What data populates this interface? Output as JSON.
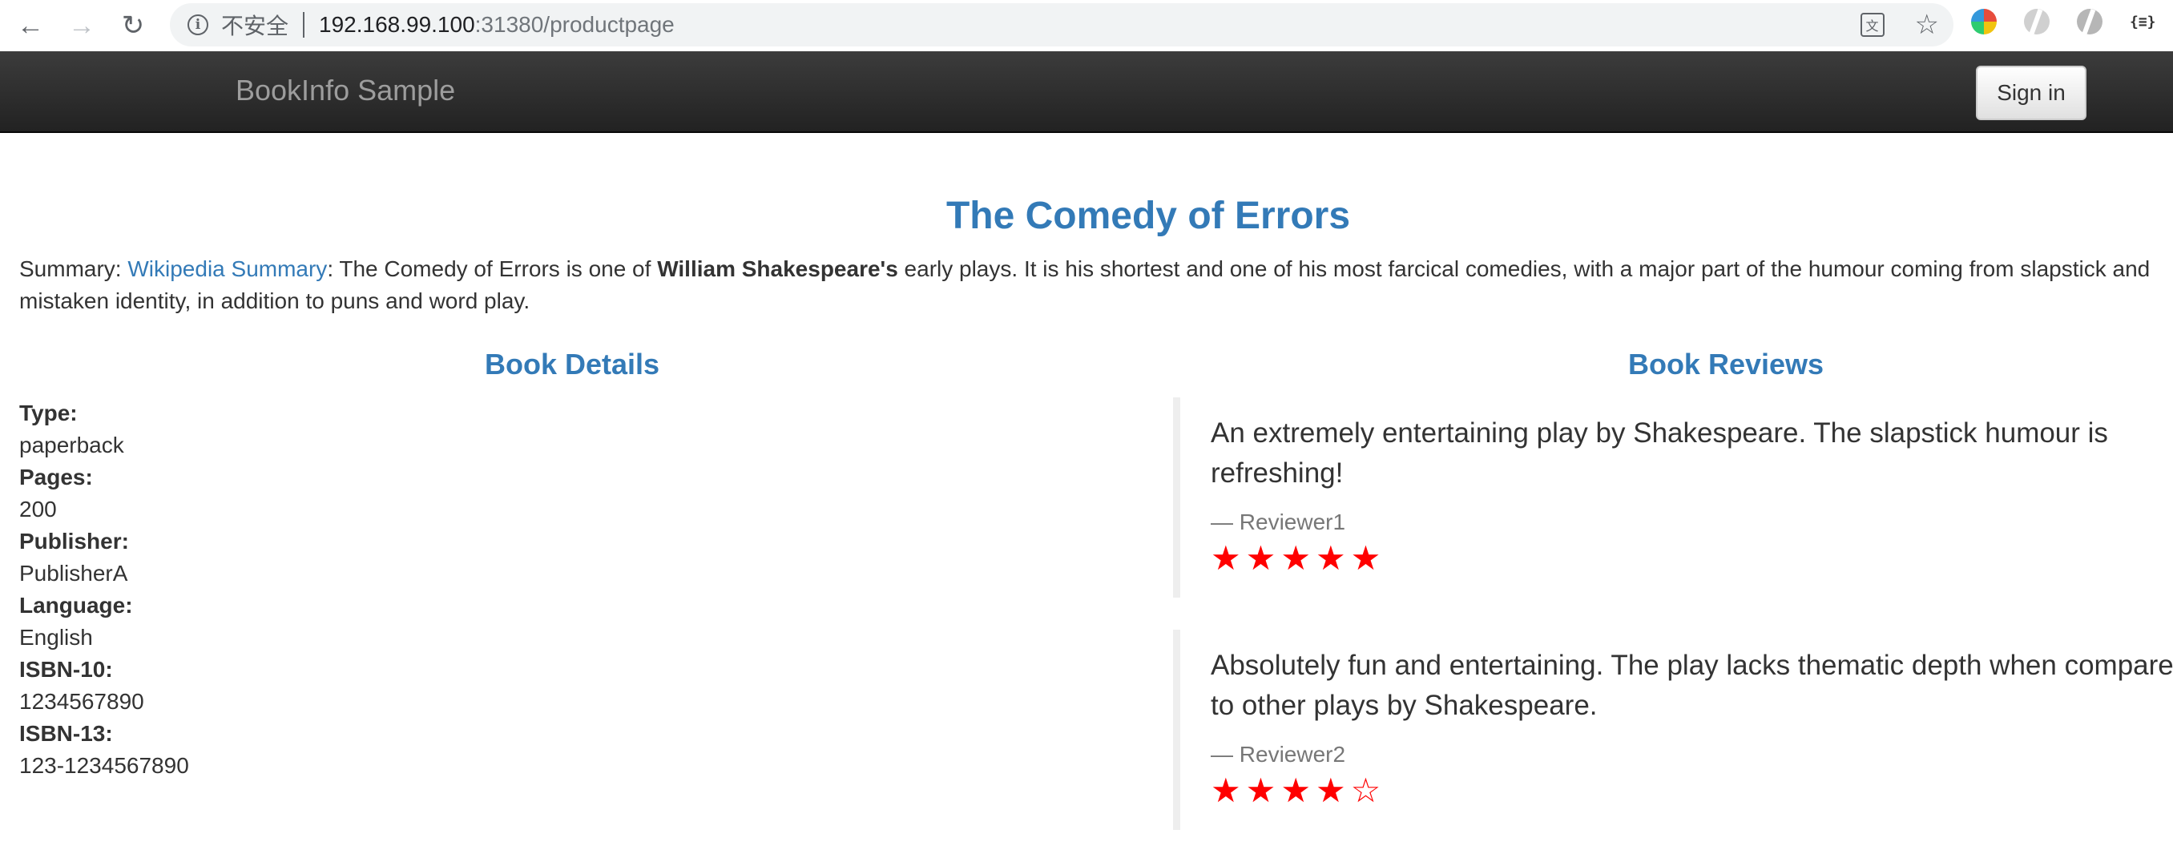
{
  "browser": {
    "insecure_label": "不安全",
    "url_host": "192.168.99.100",
    "url_rest": ":31380/productpage",
    "ext_braces": "{≡}"
  },
  "navbar": {
    "brand": "BookInfo Sample",
    "signin_label": "Sign in"
  },
  "product": {
    "title": "The Comedy of Errors",
    "summary_prefix": "Summary: ",
    "summary_link": "Wikipedia Summary",
    "summary_text_1": ": The Comedy of Errors is one of ",
    "summary_bold": "William Shakespeare's",
    "summary_text_2": " early plays. It is his shortest and one of his most farcical comedies, with a major part of the humour coming from slapstick and mistaken identity, in addition to puns and word play."
  },
  "details": {
    "heading": "Book Details",
    "items": [
      {
        "label": "Type:",
        "value": "paperback"
      },
      {
        "label": "Pages:",
        "value": "200"
      },
      {
        "label": "Publisher:",
        "value": "PublisherA"
      },
      {
        "label": "Language:",
        "value": "English"
      },
      {
        "label": "ISBN-10:",
        "value": "1234567890"
      },
      {
        "label": "ISBN-13:",
        "value": "123-1234567890"
      }
    ]
  },
  "reviews": {
    "heading": "Book Reviews",
    "items": [
      {
        "text": "An extremely entertaining play by Shakespeare. The slapstick humour is refreshing!",
        "author": "— Reviewer1",
        "rating": 5,
        "max_rating": 5,
        "star_color": "#ff0000"
      },
      {
        "text": "Absolutely fun and entertaining. The play lacks thematic depth when compared to other plays by Shakespeare.",
        "author": "— Reviewer2",
        "rating": 4,
        "max_rating": 5,
        "star_color": "#ff0000"
      }
    ]
  }
}
